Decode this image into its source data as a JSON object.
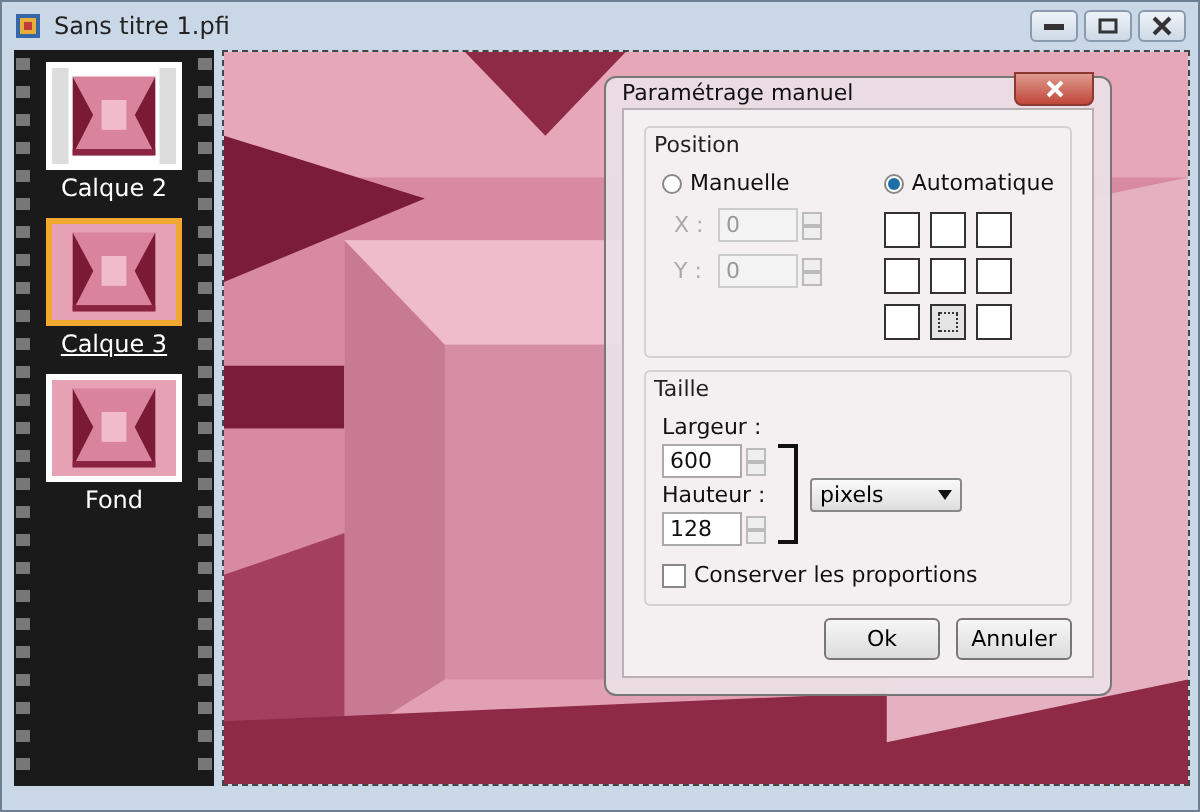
{
  "window": {
    "title": "Sans titre 1.pfi"
  },
  "layers": [
    {
      "name": "Calque 2",
      "selected": false,
      "transparent": true
    },
    {
      "name": "Calque 3",
      "selected": true,
      "transparent": false
    },
    {
      "name": "Fond",
      "selected": false,
      "transparent": false
    }
  ],
  "dialog": {
    "title": "Paramétrage manuel",
    "position": {
      "label": "Position",
      "modes": [
        {
          "label": "Manuelle",
          "selected": false
        },
        {
          "label": "Automatique",
          "selected": true
        }
      ],
      "fields": [
        {
          "label": "X :",
          "value": "0",
          "disabled": true
        },
        {
          "label": "Y :",
          "value": "0",
          "disabled": true
        }
      ],
      "anchors": [
        {
          "selected": false
        },
        {
          "selected": false
        },
        {
          "selected": false
        },
        {
          "selected": false
        },
        {
          "selected": false
        },
        {
          "selected": false
        },
        {
          "selected": false
        },
        {
          "selected": true
        },
        {
          "selected": false
        }
      ]
    },
    "size": {
      "label": "Taille",
      "fields": [
        {
          "label": "Largeur :",
          "value": "600"
        },
        {
          "label": "Hauteur :",
          "value": "128"
        }
      ],
      "unit": "pixels",
      "keep_proportions": {
        "label": "Conserver les proportions",
        "checked": false
      }
    },
    "buttons": [
      "Ok",
      "Annuler"
    ]
  }
}
